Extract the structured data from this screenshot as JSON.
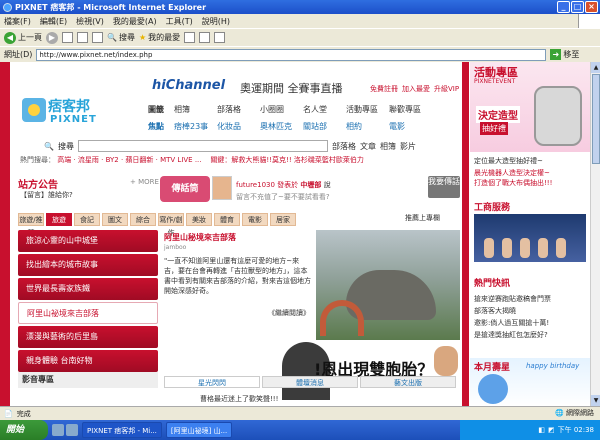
{
  "window": {
    "title": "PIXNET 痞客邦 - Microsoft Internet Explorer"
  },
  "menu": [
    "檔案(F)",
    "編輯(E)",
    "檢視(V)",
    "我的最愛(A)",
    "工具(T)",
    "說明(H)"
  ],
  "toolbar": {
    "back": "上一頁",
    "search": "搜尋",
    "favorites": "我的最愛"
  },
  "address": {
    "label": "網址(D)",
    "url": "http://www.pixnet.net/index.php",
    "go": "移至"
  },
  "site": {
    "logo_cn": "痞客邦",
    "logo_en": "PIXNET",
    "hichannel": "hiChannel",
    "hichannel_sub": "奧運期間 全賽事直播",
    "toplinks": [
      "免費註冊",
      "加入最愛",
      "升級VIP"
    ],
    "cat_row1_label": "圖籤",
    "cat_row1": [
      "相簿",
      "部落格",
      "小圈圈",
      "名人堂",
      "活動專區",
      "聯歡專區"
    ],
    "cat_row2_label": "焦點",
    "cat_row2": [
      "痞棒23事",
      "化妝品",
      "奧林匹克",
      "關站部",
      "相約",
      "電影"
    ],
    "search_label": "搜尋",
    "search_opts": [
      "部落格",
      "文章",
      "相簿",
      "影片"
    ],
    "hot_label": "熱門搜尋：",
    "hot_items": "高端 · 流星雨 · BY2 · 蘋日翻新 · MTV LIVE ...",
    "hot_right": "關鍵：解救大熊貓!!莫克!! 洛杉磯菜籃村歐萊伯力",
    "announcement_title": "站方公告",
    "announcement_more": "+ MORE",
    "announcement_item": "【留言】誰給你?",
    "rumor_label": "傳話筒",
    "rumor_user": "future1030 發表於",
    "rumor_user_loc": "中壢部",
    "rumor_suffix": "說",
    "rumor_msg": "留言不充值了~要不要試看看?",
    "rumor_btn": "我要傳話",
    "tabs": [
      "旅遊/推薦",
      "旅遊",
      "食記",
      "圖文",
      "綜合",
      "寫作/創作",
      "美妝",
      "體育",
      "電影",
      "居家"
    ],
    "tab_right": "推薦上專欄",
    "left_menu": [
      "旅涼心靈的山中城堡",
      "找出繪本的城市故事",
      "世界最長壽家族鐵",
      "阿里山祕境來吉部落",
      "漂漫與藝術的后里島",
      "親身體驗 台南好物"
    ],
    "media_title": "影音專區",
    "article_title": "阿里山秘境來吉部落",
    "article_author": "jamboo",
    "article_body": "\"一直不知道阿里山還有這麼可愛的地方~來吉，要在台會再轉進「吉拉獸型的地方」，這本書中看到有關來吉部落的介紹，對來吉這個地方開始深感好奇。",
    "article_more": "《繼續閱讀》",
    "banner_text": "!恩出現雙胞胎？",
    "bottom_tabs": [
      "星光閃閃",
      "體壇消息",
      "藝文出版"
    ],
    "news_line": "曹格最近迷上了歡笑聲!!!",
    "right_event_title": "活動專區",
    "right_event_sub": "PIXNETEVENT",
    "right_event_promo1": "決定造型",
    "right_event_promo2": "抽好禮",
    "right_event_line1": "定位最大造型抽好禮~",
    "right_event_line2": "晨光機器人造型決定權~",
    "right_event_line3": "打造個了戰大布偶抽出!!!",
    "service_title": "工商服務",
    "hot_news_title": "熱門快訊",
    "hot_news": [
      "搶來逆賽跑貼邀稿會門票",
      "部落客大揭曉",
      "邀影:倘人過互關搶十萬!",
      "是搶達獎抽紅包怎麼好?"
    ],
    "birthday_title": "本月壽星",
    "birthday_sub": "happy birthday"
  },
  "status": {
    "text": "完成",
    "zone": "網際網路"
  },
  "taskbar": {
    "start": "開始",
    "tasks": [
      "PIXNET 痞客邦 - Mi...",
      "[阿里山祕境] 山..."
    ],
    "clock": "下午 02:38"
  }
}
